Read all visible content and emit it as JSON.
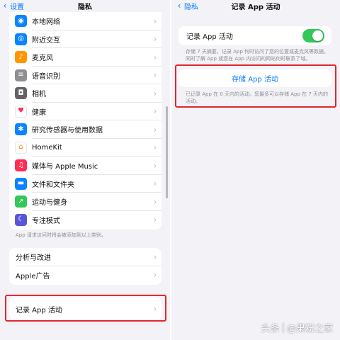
{
  "left": {
    "nav": {
      "back_label": "设置",
      "title": "隐私"
    },
    "apps": [
      {
        "label": "本地网络",
        "icon": "globe-network-icon",
        "color": "#0a84ff",
        "glyph": "◉"
      },
      {
        "label": "附近交互",
        "icon": "nearby-interaction-icon",
        "color": "#0a84ff",
        "glyph": "◎"
      },
      {
        "label": "麦克风",
        "icon": "microphone-icon",
        "color": "#ff9500",
        "glyph": "♪"
      },
      {
        "label": "语音识别",
        "icon": "speech-waveform-icon",
        "color": "#8e8e93",
        "glyph": "≡"
      },
      {
        "label": "相机",
        "icon": "camera-icon",
        "color": "#636366",
        "glyph": "◘"
      },
      {
        "label": "健康",
        "icon": "health-heart-icon",
        "color": "#ffffff",
        "glyph": "♥"
      },
      {
        "label": "研究传感器与使用数据",
        "icon": "research-icon",
        "color": "#0a84ff",
        "glyph": "✱"
      },
      {
        "label": "HomeKit",
        "icon": "homekit-house-icon",
        "color": "#ff9500",
        "glyph": "⌂"
      },
      {
        "label": "媒体与 Apple Music",
        "icon": "music-note-icon",
        "color": "#ff2d55",
        "glyph": "♫"
      },
      {
        "label": "文件和文件夹",
        "icon": "folder-icon",
        "color": "#0a84ff",
        "glyph": "▬"
      },
      {
        "label": "运动与健身",
        "icon": "fitness-runner-icon",
        "color": "#34c759",
        "glyph": "➚"
      },
      {
        "label": "专注模式",
        "icon": "focus-moon-icon",
        "color": "#5856d6",
        "glyph": "☾"
      }
    ],
    "footnote": "App 请求访问时将会被添加到以上类别。",
    "analytics": [
      {
        "label": "分析与改进"
      },
      {
        "label": "Apple广告"
      }
    ],
    "record": {
      "label": "记录 App 活动"
    }
  },
  "right": {
    "nav": {
      "back_label": "隐私",
      "title": "记录 App 活动"
    },
    "toggle": {
      "label": "记录 App 活动",
      "on": true
    },
    "toggle_description": "存储 7 天摘要，记录 App 何时访问了您的位置或麦克风等数据。同时了解 App 或您在 App 内访问的网站何时联系了域。",
    "save_button": "存储 App 活动",
    "save_description": "已记录 App 在 0 天内的活动。您最多可以存储 App 在 7 天内的活动。"
  },
  "watermark": {
    "source": "头条",
    "author": "@果粉之家"
  },
  "colors": {
    "accent": "#0a7cff",
    "switch_on": "#34c759",
    "highlight": "#e0282e"
  }
}
